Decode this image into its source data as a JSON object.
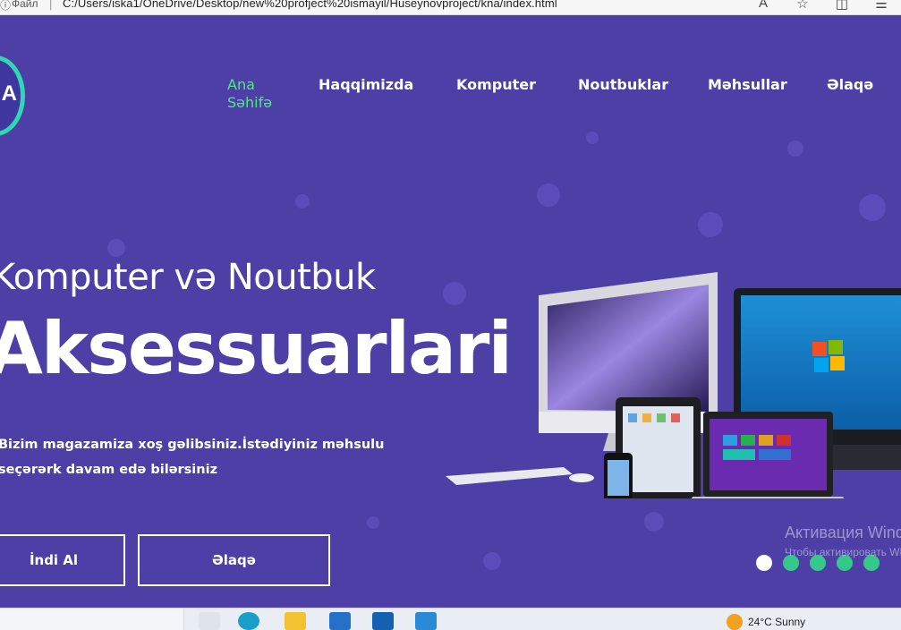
{
  "browser": {
    "file_label": "Файл",
    "url": "C:/Users/iska1/OneDrive/Desktop/new%20profject%20ismayil/Huseynovproject/kna/index.html"
  },
  "nav": {
    "items": [
      {
        "label": "Ana Səhifə",
        "active": true
      },
      {
        "label": "Haqqimizda"
      },
      {
        "label": "Komputer"
      },
      {
        "label": "Noutbuklar"
      },
      {
        "label": "Məhsullar"
      },
      {
        "label": "Əlaqə"
      }
    ]
  },
  "hero": {
    "subtitle": "Komputer və Noutbuk",
    "title": "Aksessuarlari",
    "description": "Bizim magazamiza xoş gəlibsiniz.İstədiyiniz məhsulu seçərərk davam edə bilərsiniz",
    "button_buy": "İndi Al",
    "button_contact": "Əlaqə"
  },
  "logo": {
    "letter": "A"
  },
  "slider": {
    "count": 5,
    "active_index": 0
  },
  "watermark": {
    "line1": "Активация Windows",
    "line2": "Чтобы активировать Windows, перейдите в раздел \"Параметры\"."
  },
  "taskbar": {
    "weather": "24°C  Sunny"
  },
  "colors": {
    "background": "#4d3fa6",
    "active_nav": "#4cec7c",
    "logo_ring": "#2fd8b0",
    "slider_dot": "#34c98a"
  }
}
